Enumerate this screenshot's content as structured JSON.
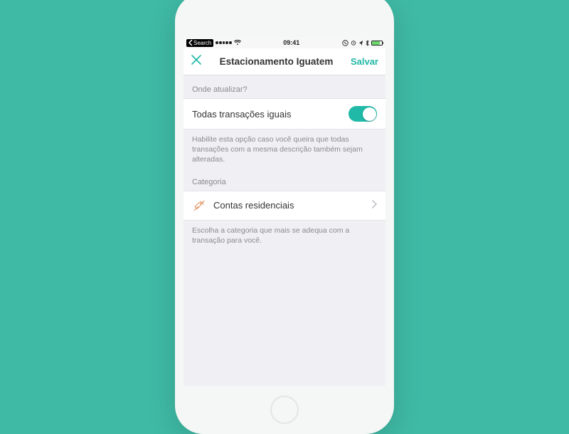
{
  "statusbar": {
    "back_label": "Search",
    "time": "09:41"
  },
  "nav": {
    "title": "Estacionamento Iguatem",
    "save": "Salvar"
  },
  "section1": {
    "header": "Onde atualizar?",
    "row_label": "Todas transações iguais",
    "caption": "Habilite esta opção caso você queira que todas transações com a mesma descrição também sejam alteradas."
  },
  "section2": {
    "header": "Categoria",
    "row_label": "Contas residenciais",
    "caption": "Escolha a categoria que mais se adequa com a transação para você."
  },
  "colors": {
    "accent": "#20b8a6"
  }
}
